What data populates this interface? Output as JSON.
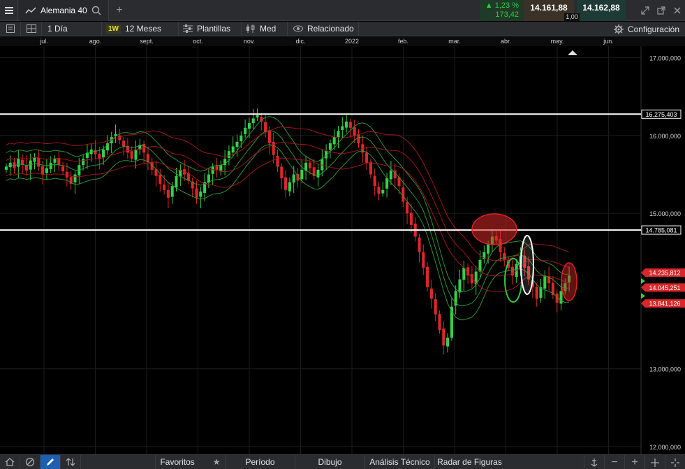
{
  "instrument": {
    "name": "Alemania 40"
  },
  "quote": {
    "change_pct": "1,23 %",
    "change_abs": "173,42",
    "sell": "14.161,88",
    "buy": "14.162,88",
    "spread": "1,00"
  },
  "toolbar": {
    "interval": "1 Día",
    "badge": "1W",
    "period": "12 Meses",
    "templates": "Plantillas",
    "mode": "Med",
    "related": "Relacionado",
    "config": "Configuración"
  },
  "bottom_tabs": [
    "Favoritos",
    "Período",
    "Dibujo",
    "Análisis Técnico",
    "Radar de Figuras"
  ],
  "colors": {
    "up": "#32d24a",
    "down": "#e0262a",
    "ma_green": "#2ea43a",
    "ma_red": "#b01a1a",
    "accent_blue": "#1e5fb0",
    "label_red": "#d8262a"
  },
  "icons": [
    "menu-icon",
    "line-chart-icon",
    "search-icon",
    "plus-icon",
    "expand-icon",
    "popout-icon",
    "close-icon",
    "gear-icon",
    "eye-icon",
    "candles-icon",
    "sliders-icon",
    "grid-icon",
    "circle-slash-icon",
    "pencil-icon",
    "arrows-icon",
    "star-icon",
    "minus-icon",
    "crosshair-icon"
  ],
  "chart_data": {
    "type": "candlestick",
    "x_labels": [
      "jul.",
      "ago.",
      "sept.",
      "oct.",
      "nov.",
      "dic.",
      "2022",
      "feb.",
      "mar.",
      "abr.",
      "may.",
      "jun."
    ],
    "y_ticks": [
      "17.000,000",
      "16.000,000",
      "15.000,000",
      "13.000,000",
      "12.000,000"
    ],
    "y_range": [
      11900,
      17150
    ],
    "horizontal_lines": [
      {
        "value": 16275.403,
        "label": "16.275,403"
      },
      {
        "value": 14785.081,
        "label": "14.785,081"
      }
    ],
    "price_labels": [
      "14.235,812",
      "14.045,251",
      "13.841,126"
    ],
    "price_label_values": [
      14235.812,
      14045.251,
      13841.126
    ],
    "series_close": [
      15600,
      15650,
      15580,
      15700,
      15620,
      15550,
      15680,
      15720,
      15600,
      15500,
      15580,
      15650,
      15700,
      15620,
      15540,
      15460,
      15380,
      15500,
      15620,
      15700,
      15780,
      15820,
      15760,
      15700,
      15820,
      15900,
      15980,
      16020,
      15940,
      15860,
      15780,
      15700,
      15820,
      15880,
      15780,
      15660,
      15560,
      15480,
      15380,
      15300,
      15200,
      15350,
      15480,
      15560,
      15500,
      15420,
      15320,
      15200,
      15280,
      15400,
      15500,
      15600,
      15560,
      15620,
      15700,
      15800,
      15860,
      15920,
      16000,
      16100,
      16160,
      16220,
      16260,
      16180,
      16050,
      15900,
      15750,
      15600,
      15450,
      15300,
      15400,
      15500,
      15420,
      15560,
      15650,
      15580,
      15480,
      15560,
      15700,
      15800,
      15900,
      15980,
      16060,
      16120,
      16180,
      16100,
      16000,
      15900,
      15780,
      15650,
      15500,
      15350,
      15250,
      15300,
      15450,
      15550,
      15450,
      15350,
      15150,
      15000,
      14850,
      14700,
      14500,
      14300,
      14050,
      13900,
      13700,
      13500,
      13300,
      13400,
      13800,
      14000,
      14150,
      14300,
      14200,
      14100,
      14250,
      14400,
      14500,
      14600,
      14700,
      14650,
      14500,
      14400,
      14300,
      14200,
      14350,
      14450,
      14300,
      14150,
      14050,
      13900,
      14050,
      14200,
      14100,
      13950,
      13850,
      14000,
      14100,
      14200
    ]
  }
}
